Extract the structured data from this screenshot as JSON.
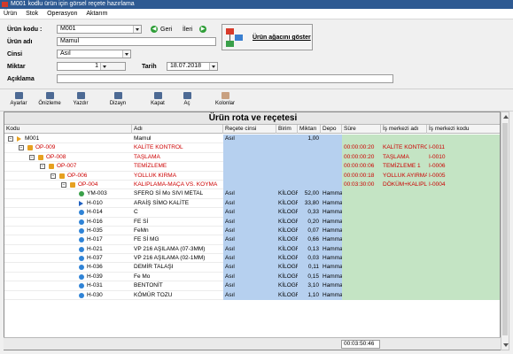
{
  "window": {
    "title": "M001 kodlu ürün için görsel reçete hazırlama"
  },
  "menu": [
    "Ürün",
    "Stok",
    "Operasyon",
    "Aktarım"
  ],
  "form": {
    "urun_kodu_label": "Ürün kodu :",
    "urun_kodu_value": "M001",
    "geri_label": "Geri",
    "ileri_label": "İleri",
    "urun_adi_label": "Ürün adı",
    "urun_adi_value": "Mamul",
    "cinsi_label": "Cinsi",
    "cinsi_value": "Asıl",
    "miktar_label": "Miktar",
    "miktar_value": "1",
    "tarih_label": "Tarih",
    "tarih_value": "18.07.2018",
    "aciklama_label": "Açıklama",
    "aciklama_value": "",
    "tree_button_label": "Ürün ağacını göster"
  },
  "toolbar": [
    {
      "label": "Ayarlar",
      "icon": "settings-icon"
    },
    {
      "label": "Önizleme",
      "icon": "preview-icon"
    },
    {
      "label": "Yazdır",
      "icon": "printer-icon"
    },
    {
      "label": "Dizayn",
      "icon": "design-icon"
    },
    {
      "label": "Kapat",
      "icon": "collapse-icon"
    },
    {
      "label": "Aç",
      "icon": "expand-icon"
    },
    {
      "label": "Kolonlar",
      "icon": "columns-icon"
    }
  ],
  "grid": {
    "title": "Ürün rota ve reçetesi",
    "columns": [
      "Kodu",
      "Adı",
      "Reçete cinsi",
      "Birim",
      "Miktarı",
      "Depo",
      "Süre",
      "İş merkezi adı",
      "İş merkezi kodu"
    ],
    "rows": [
      {
        "kodu": "M001",
        "adi": "Mamul",
        "recete": "Asıl",
        "birim": "",
        "miktar": "1,00",
        "depo": "",
        "sure": "",
        "is_adi": "",
        "is_kodu": "",
        "level": 0,
        "icon": "triangle",
        "red": false
      },
      {
        "kodu": "OP-009",
        "adi": "KALİTE KONTROL",
        "recete": "",
        "birim": "",
        "miktar": "",
        "depo": "",
        "sure": "00:00:00:20",
        "is_adi": "KALİTE KONTROL",
        "is_kodu": "I-0011",
        "level": 1,
        "icon": "op",
        "red": true
      },
      {
        "kodu": "OP-008",
        "adi": "TAŞLAMA",
        "recete": "",
        "birim": "",
        "miktar": "",
        "depo": "",
        "sure": "00:00:00:20",
        "is_adi": "TAŞLAMA",
        "is_kodu": "I-0010",
        "level": 2,
        "icon": "op",
        "red": true
      },
      {
        "kodu": "OP-007",
        "adi": "TEMİZLEME",
        "recete": "",
        "birim": "",
        "miktar": "",
        "depo": "",
        "sure": "00:00:00:06",
        "is_adi": "TEMİZLEME 1",
        "is_kodu": "I-0006",
        "level": 3,
        "icon": "op",
        "red": true
      },
      {
        "kodu": "OP-006",
        "adi": "YOLLUK KIRMA",
        "recete": "",
        "birim": "",
        "miktar": "",
        "depo": "",
        "sure": "00:00:00:18",
        "is_adi": "YOLLUK AYIRMA",
        "is_kodu": "I-0005",
        "level": 4,
        "icon": "op",
        "red": true
      },
      {
        "kodu": "OP-004",
        "adi": "KALIPLAMA-MAÇA VS. KOYMA",
        "recete": "",
        "birim": "",
        "miktar": "",
        "depo": "",
        "sure": "00:03:30:00",
        "is_adi": "DÖKÜM+KALIPL",
        "is_kodu": "I-0004",
        "level": 5,
        "icon": "op",
        "red": true
      },
      {
        "kodu": "YM-003",
        "adi": "SFERO Sİ Mo SIVI METAL",
        "recete": "Asıl",
        "birim": "KİLOGR",
        "miktar": "52,00",
        "depo": "Hamma",
        "sure": "",
        "is_adi": "",
        "is_kodu": "",
        "level": 6,
        "icon": "green",
        "red": false
      },
      {
        "kodu": "H-010",
        "adi": "ARAİŞ SİMO KALİTE",
        "recete": "Asıl",
        "birim": "KİLOGR",
        "miktar": "33,80",
        "depo": "Hamma",
        "sure": "",
        "is_adi": "",
        "is_kodu": "",
        "level": 6,
        "icon": "arrow",
        "red": false
      },
      {
        "kodu": "H-014",
        "adi": "C",
        "recete": "Asıl",
        "birim": "KİLOGR",
        "miktar": "0,33",
        "depo": "Hamma",
        "sure": "",
        "is_adi": "",
        "is_kodu": "",
        "level": 6,
        "icon": "ball",
        "red": false
      },
      {
        "kodu": "H-016",
        "adi": "FE Sİ",
        "recete": "Asıl",
        "birim": "KİLOGR",
        "miktar": "0,20",
        "depo": "Hamma",
        "sure": "",
        "is_adi": "",
        "is_kodu": "",
        "level": 6,
        "icon": "ball",
        "red": false
      },
      {
        "kodu": "H-035",
        "adi": "FeMn",
        "recete": "Asıl",
        "birim": "KİLOGR",
        "miktar": "0,07",
        "depo": "Hamma",
        "sure": "",
        "is_adi": "",
        "is_kodu": "",
        "level": 6,
        "icon": "ball",
        "red": false
      },
      {
        "kodu": "H-017",
        "adi": "FE Sİ MG",
        "recete": "Asıl",
        "birim": "KİLOGR",
        "miktar": "0,66",
        "depo": "Hamma",
        "sure": "",
        "is_adi": "",
        "is_kodu": "",
        "level": 6,
        "icon": "ball",
        "red": false
      },
      {
        "kodu": "H-021",
        "adi": "VP 216 AŞILAMA (07-3MM)",
        "recete": "Asıl",
        "birim": "KİLOGR",
        "miktar": "0,13",
        "depo": "Hamma",
        "sure": "",
        "is_adi": "",
        "is_kodu": "",
        "level": 6,
        "icon": "ball",
        "red": false
      },
      {
        "kodu": "H-037",
        "adi": "VP 216 AŞILAMA (02-1MM)",
        "recete": "Asıl",
        "birim": "KİLOGR",
        "miktar": "0,03",
        "depo": "Hamma",
        "sure": "",
        "is_adi": "",
        "is_kodu": "",
        "level": 6,
        "icon": "ball",
        "red": false
      },
      {
        "kodu": "H-036",
        "adi": "DEMİR TALAŞI",
        "recete": "Asıl",
        "birim": "KİLOGR",
        "miktar": "0,11",
        "depo": "Hamma",
        "sure": "",
        "is_adi": "",
        "is_kodu": "",
        "level": 6,
        "icon": "ball",
        "red": false
      },
      {
        "kodu": "H-039",
        "adi": "Fe Mo",
        "recete": "Asıl",
        "birim": "KİLOGR",
        "miktar": "0,15",
        "depo": "Hamma",
        "sure": "",
        "is_adi": "",
        "is_kodu": "",
        "level": 6,
        "icon": "ball",
        "red": false
      },
      {
        "kodu": "H-031",
        "adi": "BENTONİT",
        "recete": "Asıl",
        "birim": "KİLOGR",
        "miktar": "3,10",
        "depo": "Hamma",
        "sure": "",
        "is_adi": "",
        "is_kodu": "",
        "level": 6,
        "icon": "ball",
        "red": false
      },
      {
        "kodu": "H-030",
        "adi": "KÖMÜR TOZU",
        "recete": "Asıl",
        "birim": "KİLOGR",
        "miktar": "1,10",
        "depo": "Hamma",
        "sure": "",
        "is_adi": "",
        "is_kodu": "",
        "level": 6,
        "icon": "ball",
        "red": false
      }
    ],
    "total_sure": "00:03:50:46"
  }
}
